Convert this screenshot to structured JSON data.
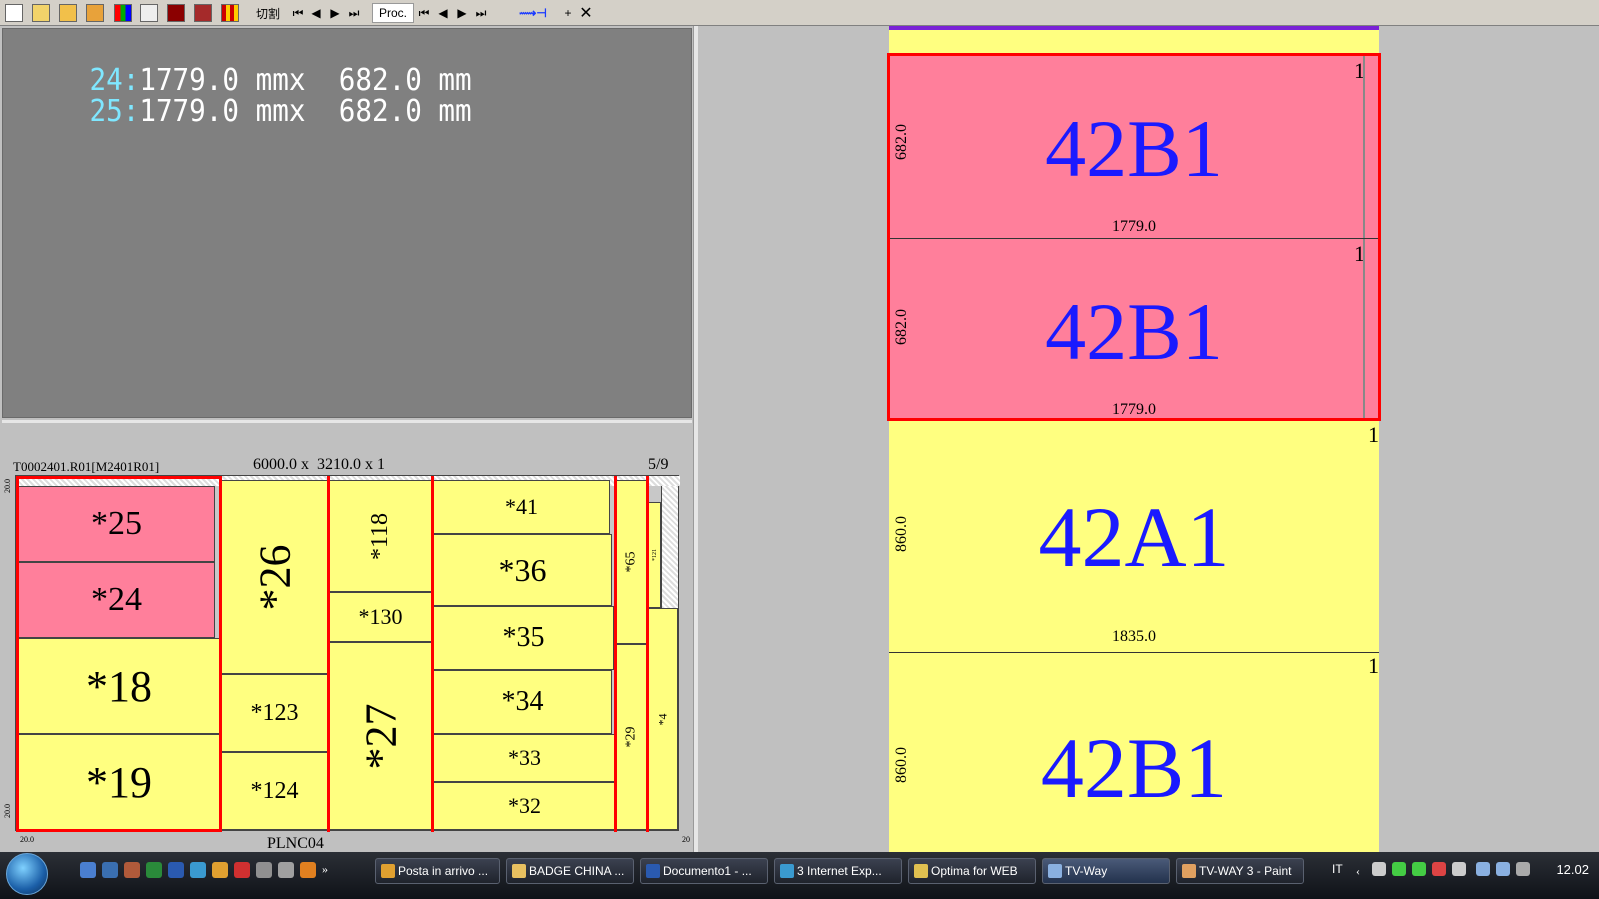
{
  "toolbar": {
    "cut_label": "切割",
    "proc_label": "Proc.",
    "icons": [
      "new-file-icon",
      "open-folder-icon",
      "open-folder-2-icon",
      "open-folder-3-icon",
      "palette-icon",
      "list-icon",
      "stop-icon",
      "panel-icon",
      "grid-icon",
      "first-icon",
      "prev-icon",
      "next-icon",
      "last-icon",
      "first-icon",
      "prev-icon",
      "next-icon",
      "last-icon",
      "measure-icon",
      "close-icon"
    ]
  },
  "info": {
    "lines": [
      {
        "idx": "24:",
        "val": "1779.0 mmx  682.0 mm"
      },
      {
        "idx": "25:",
        "val": "1779.0 mmx  682.0 mm"
      }
    ]
  },
  "layout": {
    "name": "T0002401.R01[M2401R01]",
    "size": "6000.0 x  3210.0 x 1",
    "page": "5/9",
    "footer": "PLNC04",
    "trim_top": "20.0",
    "trim_bottom": "20.0",
    "trim_left": "20.0",
    "trim_right": "20",
    "pieces": {
      "p25": "*25",
      "p24": "*24",
      "p18": "*18",
      "p19": "*19",
      "p26": "*26",
      "p123": "*123",
      "p124": "*124",
      "p118": "*118",
      "p130": "*130",
      "p27": "*27",
      "p41": "*41",
      "p36": "*36",
      "p35": "*35",
      "p34": "*34",
      "p33": "*33",
      "p32": "*32",
      "p65": "*65",
      "p29": "*29",
      "p4": "*4",
      "p121": "*121"
    }
  },
  "preview": {
    "items": [
      {
        "code": "42B1",
        "width": "1779.0",
        "height": "682.0",
        "count": "1"
      },
      {
        "code": "42B1",
        "width": "1779.0",
        "height": "682.0",
        "count": "1"
      },
      {
        "code": "42A1",
        "width": "1835.0",
        "height": "860.0",
        "count": "1"
      },
      {
        "code": "42B1",
        "width": "",
        "height": "860.0",
        "count": "1"
      }
    ]
  },
  "taskbar": {
    "buttons": [
      {
        "label": "Posta in arrivo ...",
        "icon": "mail-icon"
      },
      {
        "label": "BADGE CHINA ...",
        "icon": "mail-icon"
      },
      {
        "label": "Documento1 - ...",
        "icon": "word-icon"
      },
      {
        "label": "3 Internet Exp...",
        "icon": "ie-icon"
      },
      {
        "label": "Optima for WEB",
        "icon": "folder-icon"
      },
      {
        "label": "TV-Way",
        "icon": "window-icon"
      },
      {
        "label": "TV-WAY 3 - Paint",
        "icon": "paint-icon"
      }
    ],
    "language": "IT",
    "clock": "12.02"
  }
}
